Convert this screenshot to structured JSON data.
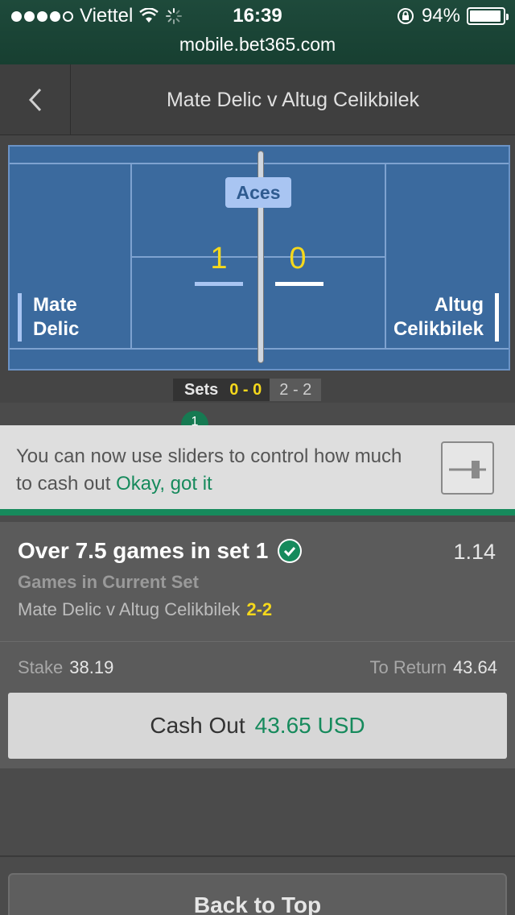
{
  "status_bar": {
    "carrier": "Viettel",
    "time": "16:39",
    "battery": "94%",
    "battery_level": 0.94,
    "signal_bars": 4
  },
  "url": "mobile.bet365.com",
  "header": {
    "title": "Mate Delic v Altug Celikbilek"
  },
  "court": {
    "stat_label": "Aces",
    "player1": {
      "first": "Mate",
      "last": "Delic",
      "stat": "1"
    },
    "player2": {
      "first": "Altug",
      "last": "Celikbilek",
      "stat": "0"
    },
    "sets_label": "Sets",
    "sets_score": "0 - 0",
    "games_score": "2 - 2",
    "current_set": "1"
  },
  "notice": {
    "text": "You can now use sliders to control how much to cash out",
    "action": "Okay, got it"
  },
  "bet": {
    "selection": "Over 7.5 games in set 1",
    "odds": "1.14",
    "market": "Games in Current Set",
    "fixture": "Mate Delic v Altug Celikbilek",
    "fixture_score": "2-2",
    "stake_label": "Stake",
    "stake_value": "38.19",
    "return_label": "To Return",
    "return_value": "43.64",
    "cashout_label": "Cash Out",
    "cashout_amount": "43.65 USD"
  },
  "footer": {
    "back_to_top": "Back to Top"
  },
  "colors": {
    "accent_green": "#168a5c",
    "score_yellow": "#f5d81c",
    "court_blue": "#3b6a9e"
  }
}
